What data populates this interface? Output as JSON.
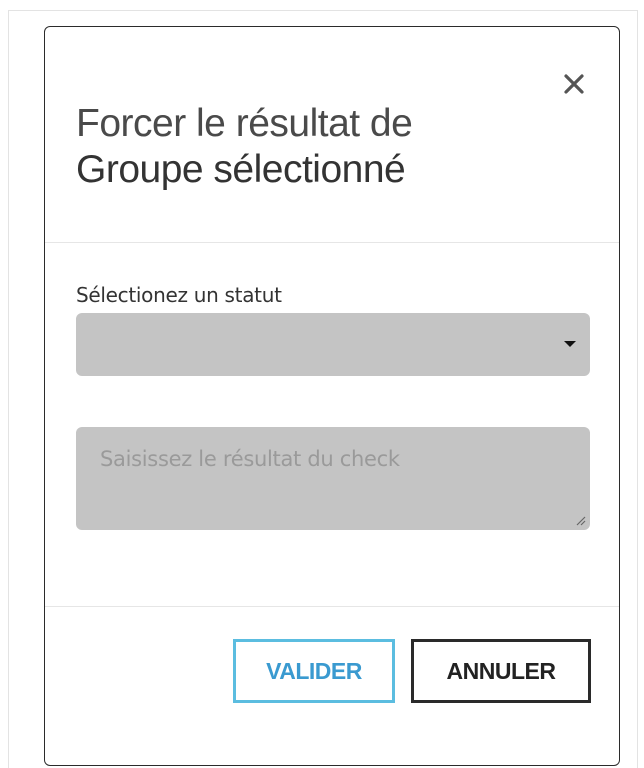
{
  "modal": {
    "title_line1": "Forcer le résultat de",
    "title_line2": "Groupe sélectionné",
    "close_icon": "close-icon"
  },
  "form": {
    "status_label": "Sélectionez un statut",
    "status_selected": "",
    "result_placeholder": "Saisissez le résultat du check"
  },
  "footer": {
    "validate_label": "VALIDER",
    "cancel_label": "ANNULER"
  },
  "colors": {
    "field_bg": "#c4c4c4",
    "validate_border": "#5bbde0",
    "validate_text": "#3a9ad0",
    "cancel_border": "#2a2a2a"
  }
}
